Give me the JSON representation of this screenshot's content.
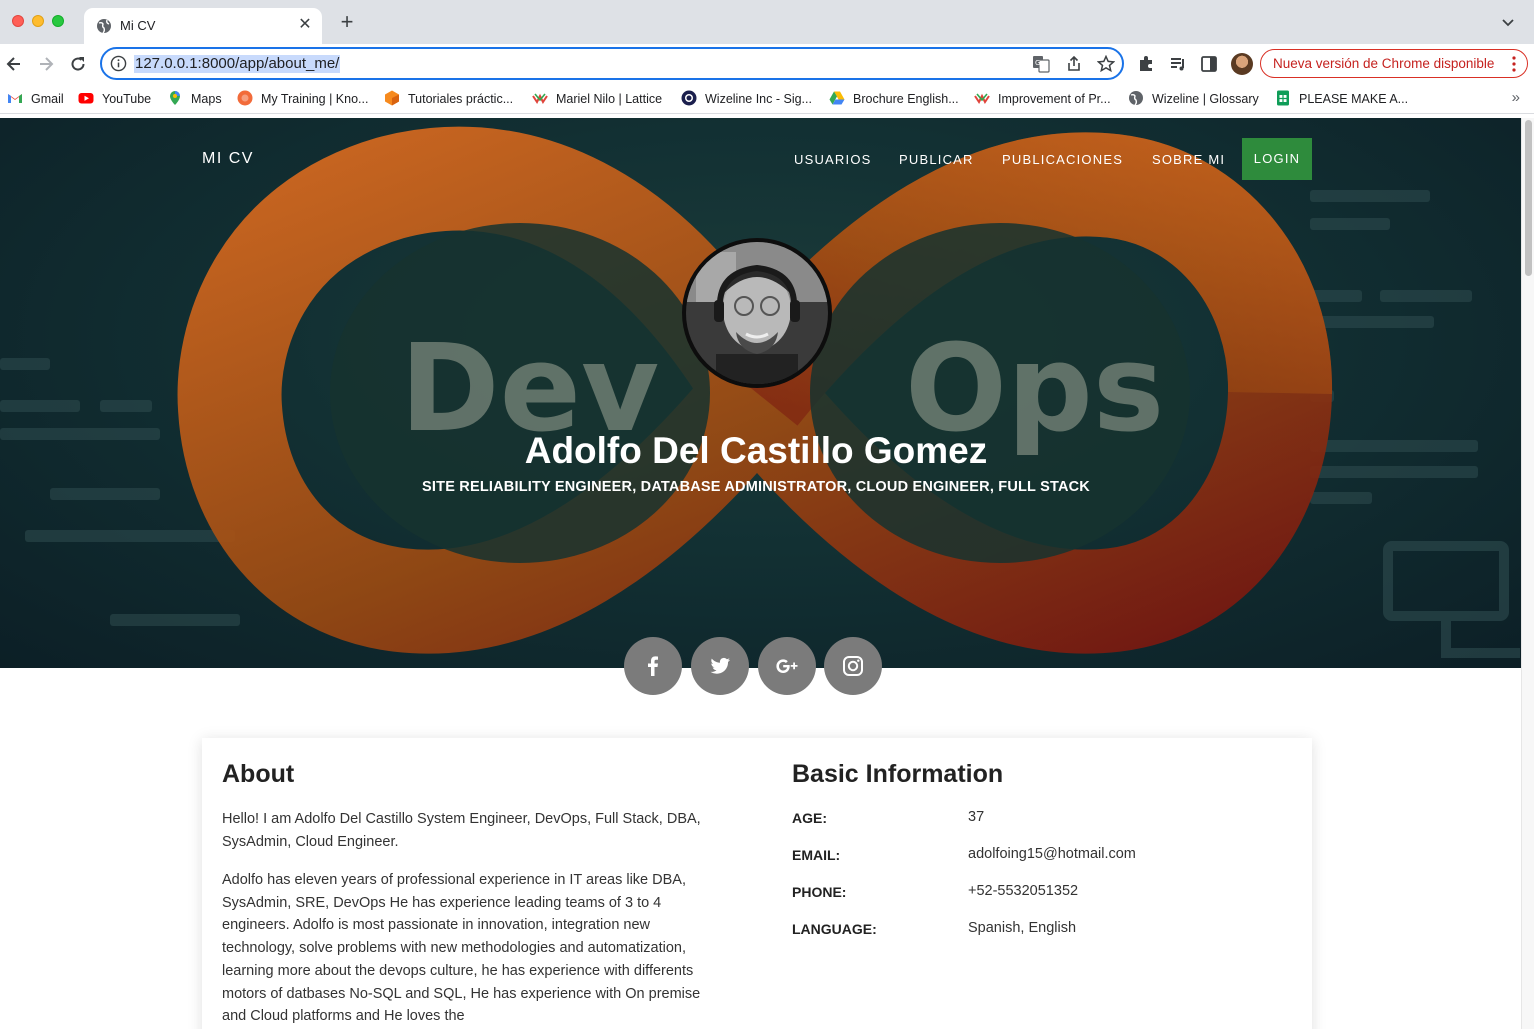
{
  "browser": {
    "tab_title": "Mi CV",
    "url": "127.0.0.1:8000/app/about_me/",
    "update_label": "Nueva versión de Chrome disponible",
    "bookmarks": [
      {
        "label": "Gmail",
        "icon": "gmail-icon"
      },
      {
        "label": "YouTube",
        "icon": "youtube-icon"
      },
      {
        "label": "Maps",
        "icon": "maps-icon"
      },
      {
        "label": "My Training | Kno...",
        "icon": "training-icon"
      },
      {
        "label": "Tutoriales práctic...",
        "icon": "tutoriales-icon"
      },
      {
        "label": "Mariel Nilo | Lattice",
        "icon": "lattice-icon"
      },
      {
        "label": "Wizeline Inc - Sig...",
        "icon": "wizeline-icon"
      },
      {
        "label": "Brochure English...",
        "icon": "drive-icon"
      },
      {
        "label": "Improvement of Pr...",
        "icon": "lattice-icon"
      },
      {
        "label": "Wizeline | Glossary",
        "icon": "globe-icon"
      },
      {
        "label": "PLEASE MAKE A...",
        "icon": "sheets-icon"
      }
    ]
  },
  "nav": {
    "brand": "MI CV",
    "links": [
      "USUARIOS",
      "PUBLICAR",
      "PUBLICACIONES",
      "SOBRE MI"
    ],
    "login": "LOGIN"
  },
  "hero": {
    "name": "Adolfo Del Castillo Gomez",
    "subtitle": "SITE RELIABILITY ENGINEER, DATABASE ADMINISTRATOR, CLOUD ENGINEER, FULL STACK",
    "art_text_left": "Dev",
    "art_text_right": "Ops"
  },
  "about": {
    "title": "About",
    "paragraphs": [
      "Hello! I am Adolfo Del Castillo System Engineer, DevOps, Full Stack, DBA, SysAdmin, Cloud Engineer.",
      "Adolfo has eleven years of professional experience in IT areas like DBA, SysAdmin, SRE, DevOps He has experience leading teams of 3 to 4 engineers. Adolfo is most passionate in innovation, integration new technology, solve problems with new methodologies and automatization, learning more about the devops culture, he has experience with differents motors of datbases No-SQL and SQL, He has experience with On premise and Cloud platforms and He loves the"
    ]
  },
  "basic_info": {
    "title": "Basic Information",
    "rows": [
      {
        "key": "AGE:",
        "value": "37"
      },
      {
        "key": "EMAIL:",
        "value": "adolfoing15@hotmail.com"
      },
      {
        "key": "PHONE:",
        "value": "+52-5532051352"
      },
      {
        "key": "LANGUAGE:",
        "value": "Spanish, English"
      }
    ]
  },
  "colors": {
    "accent_blue": "#1a73e8",
    "login_green": "#2e8b3c",
    "social_gray": "#7b7b7b",
    "devops_orange": "#e07020",
    "devops_red": "#b8281c"
  }
}
